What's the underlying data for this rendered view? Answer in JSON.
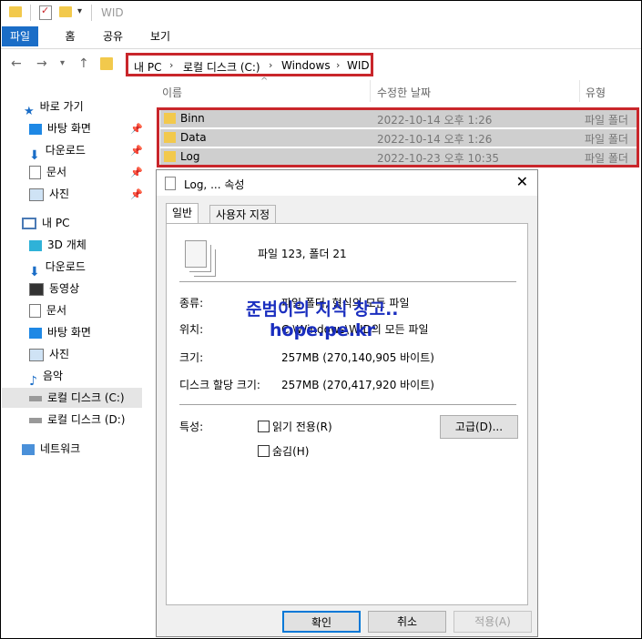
{
  "window": {
    "title": "WID"
  },
  "ribbon": {
    "tabs": [
      "파일",
      "홈",
      "공유",
      "보기"
    ]
  },
  "address": {
    "segments": [
      "내 PC",
      "로컬 디스크 (C:)",
      "Windows",
      "WID"
    ],
    "separator": "›"
  },
  "sidebar": {
    "quick_access": "바로 가기",
    "quick_items": [
      "바탕 화면",
      "다운로드",
      "문서",
      "사진"
    ],
    "this_pc": "내 PC",
    "pc_items": [
      "3D 개체",
      "다운로드",
      "동영상",
      "문서",
      "바탕 화면",
      "사진",
      "음악",
      "로컬 디스크 (C:)",
      "로컬 디스크 (D:)"
    ],
    "network": "네트워크"
  },
  "columns": {
    "name": "이름",
    "modified": "수정한 날짜",
    "type": "유형"
  },
  "files": [
    {
      "name": "Binn",
      "date": "2022-10-14 오후 1:26",
      "type": "파일 폴더"
    },
    {
      "name": "Data",
      "date": "2022-10-14 오후 1:26",
      "type": "파일 폴더"
    },
    {
      "name": "Log",
      "date": "2022-10-23 오후 10:35",
      "type": "파일 폴더"
    }
  ],
  "dialog": {
    "title": "Log, ... 속성",
    "tabs": [
      "일반",
      "사용자 지정"
    ],
    "summary": "파일 123, 폴더 21",
    "type_label": "종류:",
    "type_value": "파일 폴더, 형식의 모든 파일",
    "location_label": "위치:",
    "location_value": "C:\\Windows\\WID의 모든 파일",
    "size_label": "크기:",
    "size_value": "257MB (270,140,905 바이트)",
    "disk_label": "디스크 할당 크기:",
    "disk_value": "257MB (270,417,920 바이트)",
    "attr_label": "특성:",
    "readonly": "읽기 전용(R)",
    "hidden": "숨김(H)",
    "advanced": "고급(D)...",
    "ok": "확인",
    "cancel": "취소",
    "apply": "적용(A)"
  },
  "watermark": {
    "line1": "준범이의 지식 창고..",
    "line2": "hope.pe.kr"
  }
}
